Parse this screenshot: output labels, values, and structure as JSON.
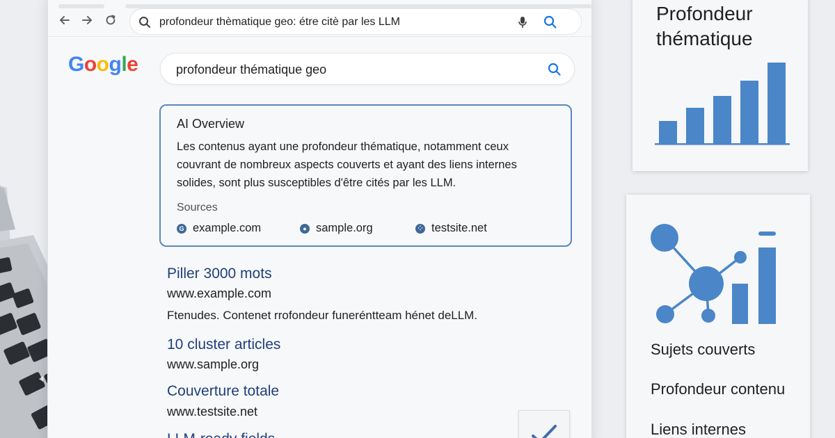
{
  "browser": {
    "address": "profondeur thèmatique geo: étre citè par les LLM"
  },
  "google": {
    "logo_letters": [
      {
        "char": "G",
        "color": "#4285F4"
      },
      {
        "char": "o",
        "color": "#EA4335"
      },
      {
        "char": "o",
        "color": "#FBBC05"
      },
      {
        "char": "g",
        "color": "#4285F4"
      },
      {
        "char": "l",
        "color": "#34A853"
      },
      {
        "char": "e",
        "color": "#EA4335"
      }
    ],
    "query": "profondeur thématique geo"
  },
  "ai_overview": {
    "title": "AI Overview",
    "body": "Les contenus ayant une profondeur thématique, notamment ceux couvrant de nombreux aspects couverts et ayant des liens internes solides, sont plus susceptibles d'être cités par les LLM.",
    "sources_label": "Sources",
    "sources": [
      "example.com",
      "sample.org",
      "testsite.net"
    ]
  },
  "results": [
    {
      "title": "Piller 3000 mots",
      "url": "www.example.com",
      "snippet": "Ftenudes. Contenet rrofondeur funeréntteam hénet deLLM."
    },
    {
      "title": "10 cluster articles",
      "url": "www.sample.org"
    },
    {
      "title": "Couverture totale",
      "url": "www.testsite.net"
    },
    {
      "title": "LLM-ready fields"
    }
  ],
  "side_cards": {
    "top_title": "Profondeur thématique",
    "features": [
      "Sujets couverts",
      "Profondeur contenu",
      "Liens internes"
    ]
  },
  "colors": {
    "accent_blue": "#4a86c8",
    "result_title": "#1f3f7a",
    "ai_border": "#5b87bf"
  },
  "icons": [
    "back-arrow-icon",
    "forward-arrow-icon",
    "reload-icon",
    "search-icon",
    "mic-icon",
    "bar-chart-icon",
    "network-chart-icon",
    "check-icon"
  ]
}
